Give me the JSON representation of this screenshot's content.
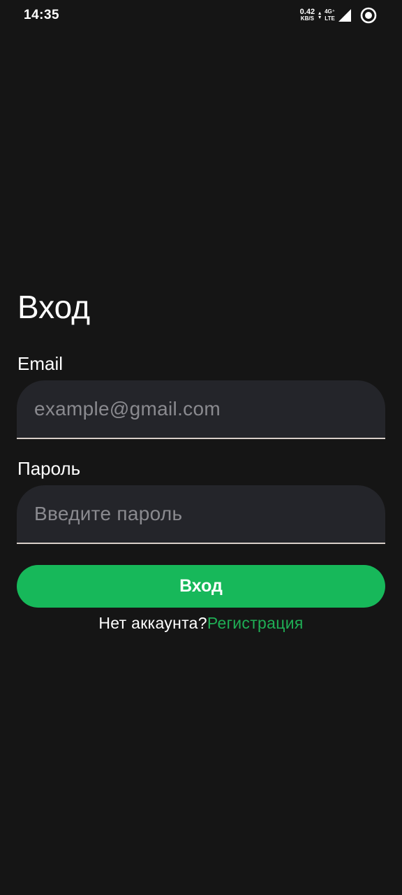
{
  "status_bar": {
    "time": "14:35",
    "net_speed_value": "0.42",
    "net_speed_unit": "KB/S",
    "network_type_top": "4G⁺",
    "network_type_bottom": "LTE",
    "icons": [
      "data-arrows-icon",
      "signal-icon",
      "record-icon"
    ]
  },
  "login": {
    "title": "Вход",
    "email_label": "Email",
    "email_value": "",
    "email_placeholder": "example@gmail.com",
    "password_label": "Пароль",
    "password_value": "",
    "password_placeholder": "Введите пароль",
    "submit_label": "Вход",
    "signup_prompt": "Нет аккаунта?",
    "signup_link": "Регистрация"
  },
  "colors": {
    "background": "#151515",
    "input_background": "#24252a",
    "accent": "#17b85a",
    "link": "#1fae55",
    "placeholder": "#8a8a8f"
  }
}
